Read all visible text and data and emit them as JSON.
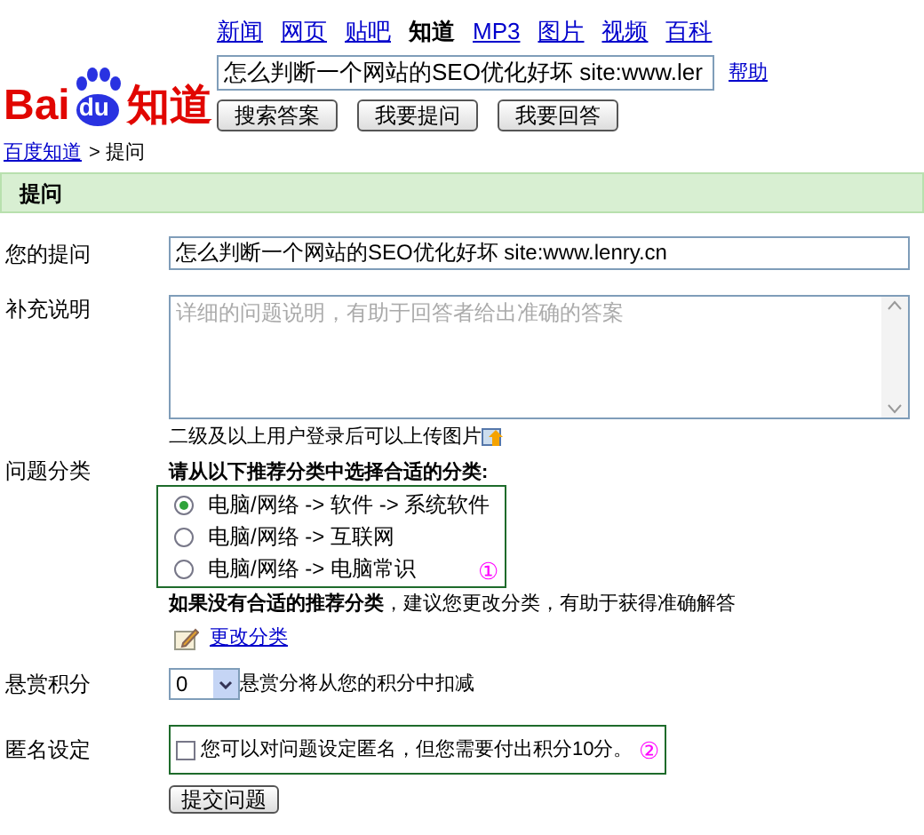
{
  "logo": {
    "part_1": "Bai",
    "part_2": "du",
    "part_3": "知道"
  },
  "nav": [
    {
      "label": "新闻",
      "selected": false
    },
    {
      "label": "网页",
      "selected": false
    },
    {
      "label": "贴吧",
      "selected": false
    },
    {
      "label": "知道",
      "selected": true
    },
    {
      "label": "MP3",
      "selected": false
    },
    {
      "label": "图片",
      "selected": false
    },
    {
      "label": "视频",
      "selected": false
    },
    {
      "label": "百科",
      "selected": false
    }
  ],
  "search": {
    "value": "怎么判断一个网站的SEO优化好坏  site:www.ler",
    "help": "帮助"
  },
  "search_buttons": [
    "搜索答案",
    "我要提问",
    "我要回答"
  ],
  "breadcrumb": {
    "link": "百度知道",
    "current": "> 提问"
  },
  "section_title": "提问",
  "question": {
    "label": "您的提问",
    "value": "怎么判断一个网站的SEO优化好坏 site:www.lenry.cn"
  },
  "details": {
    "label": "补充说明",
    "placeholder": "详细的问题说明，有助于回答者给出准确的答案",
    "upload_note": "二级及以上用户登录后可以上传图片"
  },
  "category": {
    "label": "问题分类",
    "instruction": "请从以下推荐分类中选择合适的分类:",
    "options": [
      {
        "label": "电脑/网络  -> 软件  -> 系统软件",
        "selected": true
      },
      {
        "label": "电脑/网络  -> 互联网",
        "selected": false
      },
      {
        "label": "电脑/网络  -> 电脑常识",
        "selected": false
      }
    ],
    "marker": "①",
    "note_bold": "如果没有合适的推荐分类",
    "note": "，建议您更改分类，有助于获得准确解答",
    "change_link": "更改分类"
  },
  "reward": {
    "label": "悬赏积分",
    "value": "0",
    "note": "悬赏分将从您的积分中扣减"
  },
  "anonymous": {
    "label": "匿名设定",
    "checked": false,
    "text": "您可以对问题设定匿名，但您需要付出积分10分。",
    "marker": "②"
  },
  "submit": "提交问题"
}
